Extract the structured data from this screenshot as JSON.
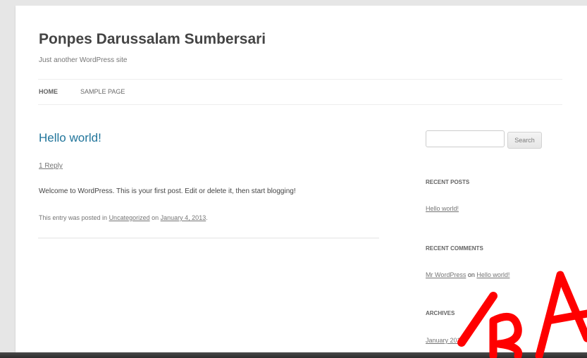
{
  "site": {
    "title": "Ponpes Darussalam Sumbersari",
    "description": "Just another WordPress site"
  },
  "nav": {
    "items": [
      {
        "label": "HOME",
        "current": true
      },
      {
        "label": "SAMPLE PAGE",
        "current": false
      }
    ]
  },
  "post": {
    "title": "Hello world!",
    "reply_link": "1 Reply",
    "content": "Welcome to WordPress. This is your first post. Edit or delete it, then start blogging!",
    "meta": {
      "prefix": "This entry was posted in",
      "category": "Uncategorized",
      "on_word": "on",
      "date": "January 4, 2013",
      "suffix": "."
    }
  },
  "sidebar": {
    "search": {
      "value": "",
      "button_label": "Search"
    },
    "recent_posts": {
      "title": "RECENT POSTS",
      "items": [
        "Hello world!"
      ]
    },
    "recent_comments": {
      "title": "RECENT COMMENTS",
      "author": "Mr WordPress",
      "on_word": "on",
      "post": "Hello world!"
    },
    "archives": {
      "title": "ARCHIVES",
      "items": [
        "January 2013"
      ]
    }
  },
  "colors": {
    "link_blue": "#21759b",
    "watermark_red": "#ff0000",
    "page_background": "#e6e6e6"
  }
}
